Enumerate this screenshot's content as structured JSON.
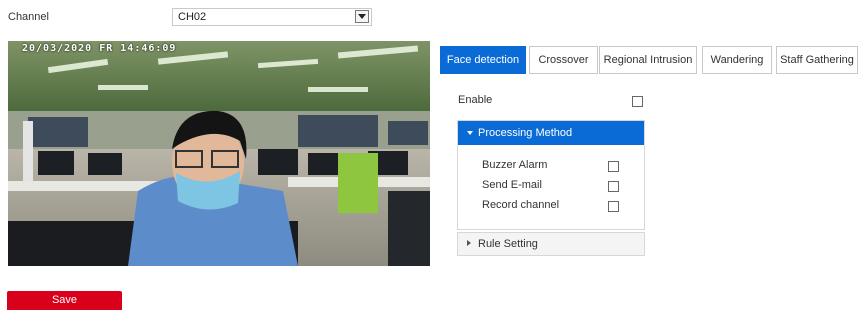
{
  "channel": {
    "label": "Channel",
    "selected": "CH02"
  },
  "video": {
    "osd_timestamp": "20/03/2020 FR 14:46:09"
  },
  "tabs": [
    {
      "label": "Face detection",
      "active": true
    },
    {
      "label": "Crossover",
      "active": false
    },
    {
      "label": "Regional Intrusion",
      "active": false
    },
    {
      "label": "Wandering",
      "active": false
    },
    {
      "label": "Staff Gathering",
      "active": false
    }
  ],
  "enable": {
    "label": "Enable",
    "checked": false
  },
  "processing_method": {
    "title": "Processing Method",
    "expanded": true,
    "options": [
      {
        "label": "Buzzer Alarm",
        "checked": false
      },
      {
        "label": "Send E-mail",
        "checked": false
      },
      {
        "label": "Record channel",
        "checked": false
      }
    ]
  },
  "rule_setting": {
    "title": "Rule Setting",
    "expanded": false
  },
  "actions": {
    "save_label": "Save"
  },
  "colors": {
    "accent": "#0a6bd6",
    "save": "#d9001b"
  }
}
